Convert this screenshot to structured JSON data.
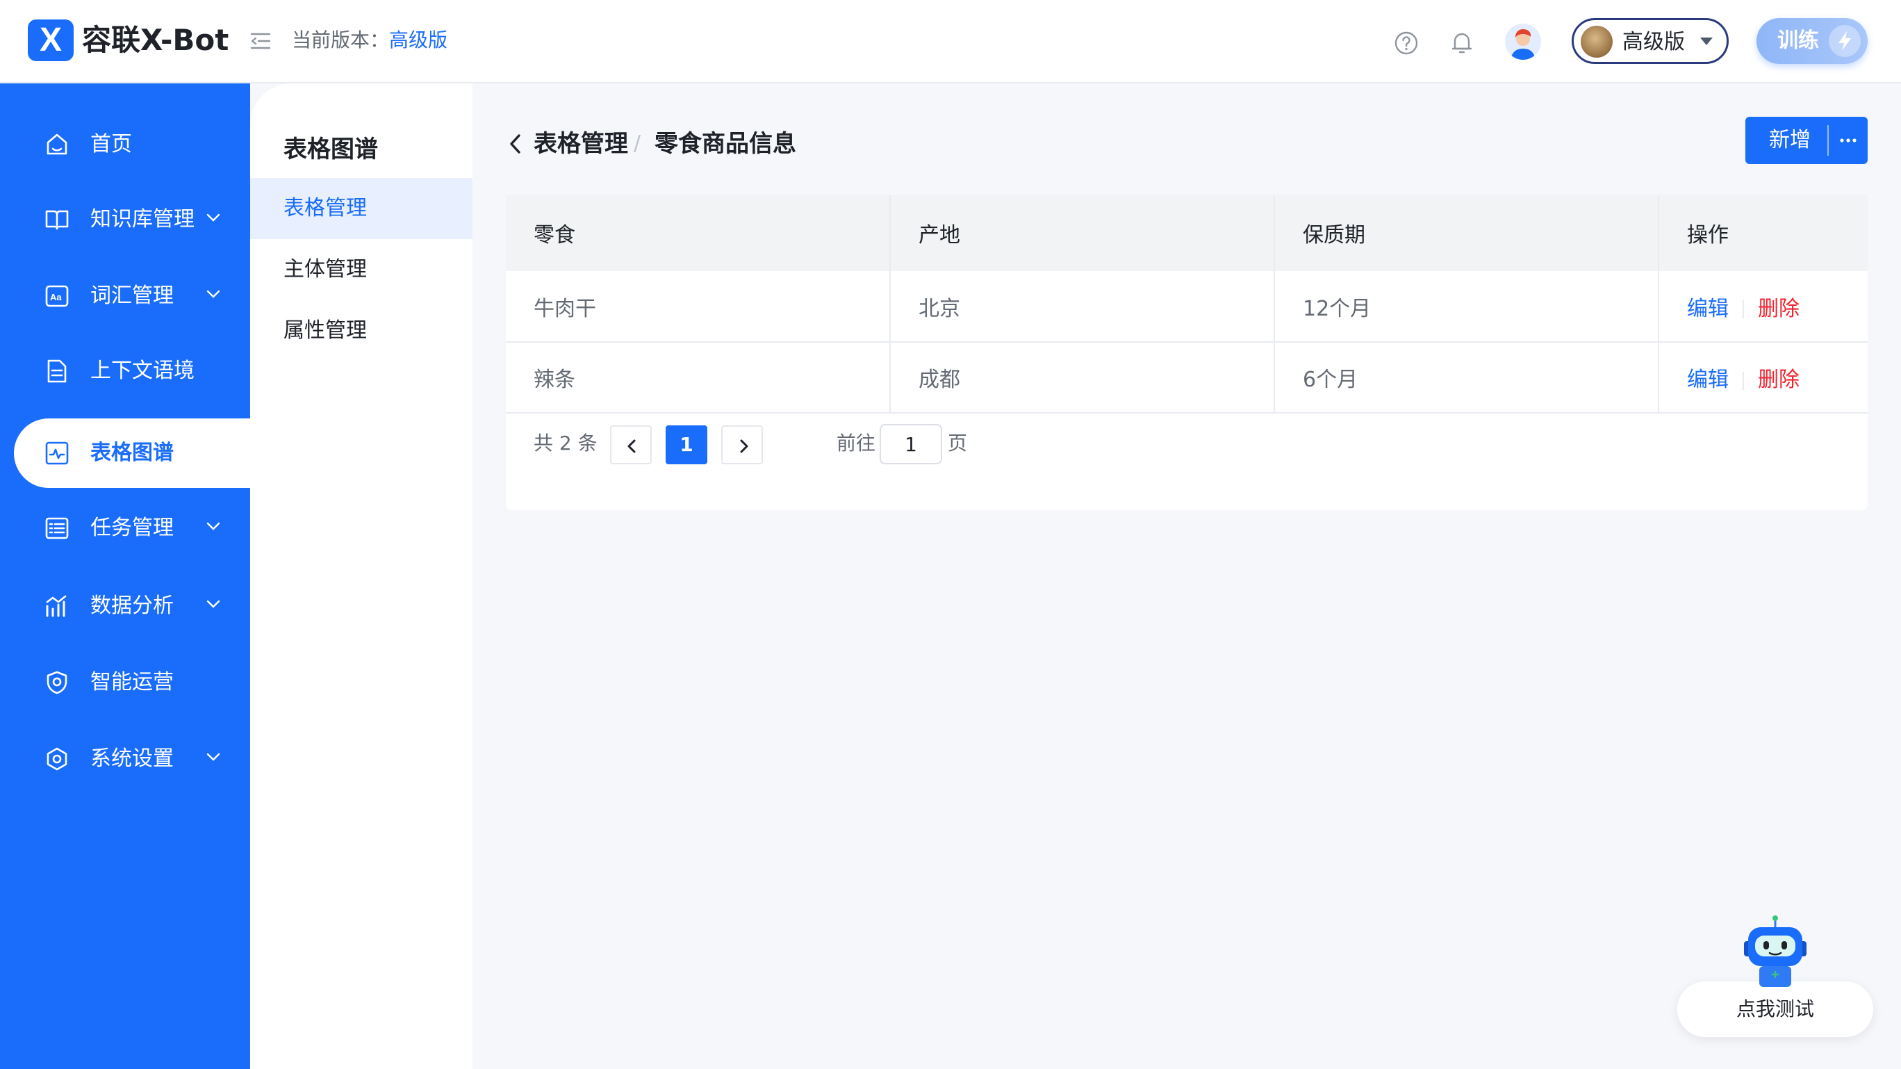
{
  "header": {
    "logo_mark": "X",
    "app_name": "容联X-Bot",
    "version_label": "当前版本：",
    "version_value": "高级版",
    "version_select": "高级版",
    "train_label": "训练"
  },
  "sidebar": {
    "items": [
      {
        "label": "首页",
        "icon": "home-icon",
        "has_children": false
      },
      {
        "label": "知识库管理",
        "icon": "book-icon",
        "has_children": true
      },
      {
        "label": "词汇管理",
        "icon": "vocabulary-icon",
        "has_children": true
      },
      {
        "label": "上下文语境",
        "icon": "document-icon",
        "has_children": false
      },
      {
        "label": "表格图谱",
        "icon": "chart-graph-icon",
        "has_children": false,
        "active": true
      },
      {
        "label": "任务管理",
        "icon": "task-list-icon",
        "has_children": true
      },
      {
        "label": "数据分析",
        "icon": "bar-chart-icon",
        "has_children": true
      },
      {
        "label": "智能运营",
        "icon": "shield-icon",
        "has_children": false
      },
      {
        "label": "系统设置",
        "icon": "settings-icon",
        "has_children": true
      }
    ]
  },
  "submenu": {
    "title": "表格图谱",
    "items": [
      {
        "label": "表格管理",
        "active": true
      },
      {
        "label": "主体管理"
      },
      {
        "label": "属性管理"
      }
    ]
  },
  "breadcrumb": {
    "parent": "表格管理",
    "separator": "/",
    "current": "零食商品信息"
  },
  "actions": {
    "add_label": "新增"
  },
  "table": {
    "columns": [
      "零食",
      "产地",
      "保质期",
      "操作"
    ],
    "rows": [
      {
        "snack": "牛肉干",
        "origin": "北京",
        "shelf_life": "12个月",
        "edit": "编辑",
        "delete": "删除"
      },
      {
        "snack": "辣条",
        "origin": "成都",
        "shelf_life": "6个月",
        "edit": "编辑",
        "delete": "删除"
      }
    ]
  },
  "pagination": {
    "total": "共 2 条",
    "current_page": "1",
    "goto_label": "前往",
    "goto_value": "1",
    "goto_suffix": "页"
  },
  "robot": {
    "label": "点我测试"
  },
  "colors": {
    "primary": "#1a6dfa",
    "danger": "#f5222d",
    "sidebar_bg": "#1a6dfa"
  }
}
